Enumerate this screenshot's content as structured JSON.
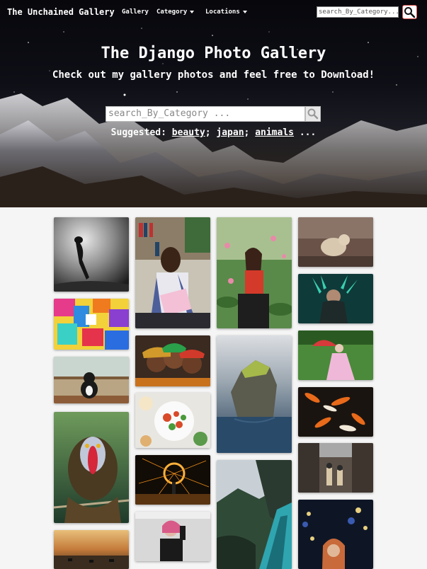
{
  "nav": {
    "brand": "The Unchained Gallery",
    "links": [
      "Gallery",
      "Category",
      "Locations"
    ],
    "search_placeholder": "search_By_Category..."
  },
  "hero": {
    "title": "The Django Photo Gallery",
    "subtitle": "Check out my gallery photos and feel free to Download!",
    "search_placeholder": "search_By_Category ...",
    "suggest_label": "Suggested:",
    "suggest_links": [
      "beauty",
      "japan",
      "animals"
    ],
    "suggest_sep": ";",
    "suggest_tail": "..."
  },
  "gallery": {
    "photos": [
      {
        "name": "diver-underwater-photo",
        "col": 0
      },
      {
        "name": "colorful-abstract-photo",
        "col": 0
      },
      {
        "name": "cat-at-window-photo",
        "col": 0
      },
      {
        "name": "mandrill-photo",
        "col": 0
      },
      {
        "name": "savanna-sunset-photo",
        "col": 0
      },
      {
        "name": "woman-reading-photo",
        "col": 1
      },
      {
        "name": "three-women-portrait-photo",
        "col": 1
      },
      {
        "name": "food-plate-photo",
        "col": 1
      },
      {
        "name": "steel-wool-fire-photo",
        "col": 1
      },
      {
        "name": "woman-pink-hair-photo",
        "col": 1
      },
      {
        "name": "woman-lotus-pond-photo",
        "col": 2
      },
      {
        "name": "sea-cliff-island-photo",
        "col": 2
      },
      {
        "name": "train-forest-photo",
        "col": 2
      },
      {
        "name": "dog-misty-photo",
        "col": 3
      },
      {
        "name": "headdress-portrait-photo",
        "col": 3
      },
      {
        "name": "girl-umbrella-photo",
        "col": 3
      },
      {
        "name": "koi-fish-photo",
        "col": 3
      },
      {
        "name": "japan-street-photo",
        "col": 3
      },
      {
        "name": "woman-night-city-photo",
        "col": 3
      }
    ]
  }
}
